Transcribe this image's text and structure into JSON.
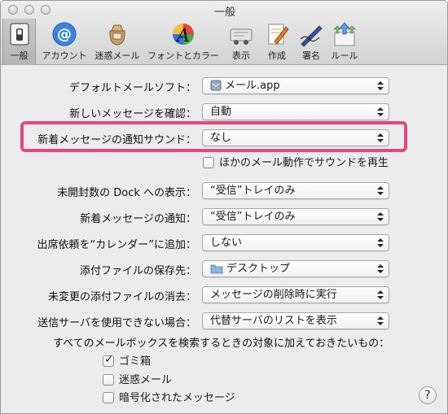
{
  "window": {
    "title": "一般"
  },
  "toolbar": {
    "items": [
      {
        "label": "一般",
        "icon": "general-switch-icon",
        "selected": true
      },
      {
        "label": "アカウント",
        "icon": "at-sign-icon"
      },
      {
        "label": "迷惑メール",
        "icon": "junk-mail-bag-icon"
      },
      {
        "label": "フォントとカラー",
        "icon": "font-color-icon"
      },
      {
        "label": "表示",
        "icon": "viewing-icon"
      },
      {
        "label": "作成",
        "icon": "compose-pencil-icon"
      },
      {
        "label": "署名",
        "icon": "signature-pen-icon"
      },
      {
        "label": "ルール",
        "icon": "rules-arrows-icon"
      }
    ]
  },
  "settings": {
    "default_mail": {
      "label": "デフォルトメールソフト：",
      "value": "メール.app"
    },
    "check_new": {
      "label": "新しいメッセージを確認：",
      "value": "自動"
    },
    "new_sound": {
      "label": "新着メッセージの通知サウンド：",
      "value": "なし"
    },
    "play_other_sounds": {
      "label": "ほかのメール動作でサウンドを再生",
      "checked": false
    },
    "dock_unread": {
      "label": "未開封数の Dock への表示：",
      "value": "“受信”トレイのみ"
    },
    "new_notify": {
      "label": "新着メッセージの通知：",
      "value": "“受信”トレイのみ"
    },
    "add_calendar": {
      "label": "出席依頼を“カレンダー”に追加：",
      "value": "しない"
    },
    "save_folder": {
      "label": "添付ファイルの保存先：",
      "value": "デスクトップ"
    },
    "remove_attach": {
      "label": "未変更の添付ファイルの消去：",
      "value": "メッセージの削除時に実行"
    },
    "outgoing": {
      "label": "送信サーバを使用できない場合：",
      "value": "代替サーバのリストを表示"
    }
  },
  "search": {
    "header": "すべてのメールボックスを検索するときの対象に加えておきたいもの：",
    "options": [
      {
        "label": "ゴミ箱",
        "checked": true
      },
      {
        "label": "迷惑メール",
        "checked": false
      },
      {
        "label": "暗号化されたメッセージ",
        "checked": false
      }
    ]
  },
  "help": {
    "label": "?"
  },
  "colors": {
    "highlight": "#e8467f"
  }
}
